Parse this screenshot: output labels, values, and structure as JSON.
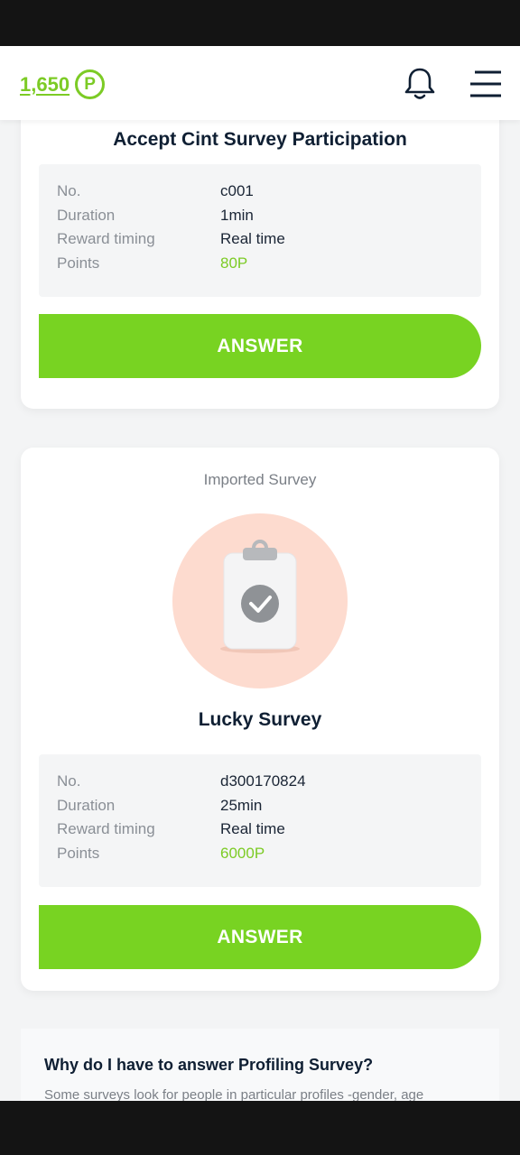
{
  "header": {
    "points_value": "1,650",
    "points_symbol": "P"
  },
  "surveys": [
    {
      "title": "Accept Cint Survey Participation",
      "info": [
        {
          "label": "No.",
          "value": "c001"
        },
        {
          "label": "Duration",
          "value": "1min"
        },
        {
          "label": "Reward timing",
          "value": "Real time"
        },
        {
          "label": "Points",
          "value": "80P"
        }
      ],
      "button_label": "ANSWER"
    },
    {
      "kind": "Imported Survey",
      "title": "Lucky Survey",
      "info": [
        {
          "label": "No.",
          "value": "d300170824"
        },
        {
          "label": "Duration",
          "value": "25min"
        },
        {
          "label": "Reward timing",
          "value": "Real time"
        },
        {
          "label": "Points",
          "value": "6000P"
        }
      ],
      "button_label": "ANSWER"
    }
  ],
  "faq": {
    "title": "Why do I have to answer Profiling Survey?",
    "text": "Some surveys look for people in particular profiles -gender, age"
  },
  "colors": {
    "accent": "#78d322",
    "points_green": "#7ccb25",
    "illustration_bg": "#fddbcf"
  },
  "icons": [
    "notification-bell-icon",
    "hamburger-menu-icon",
    "clipboard-check-icon"
  ]
}
